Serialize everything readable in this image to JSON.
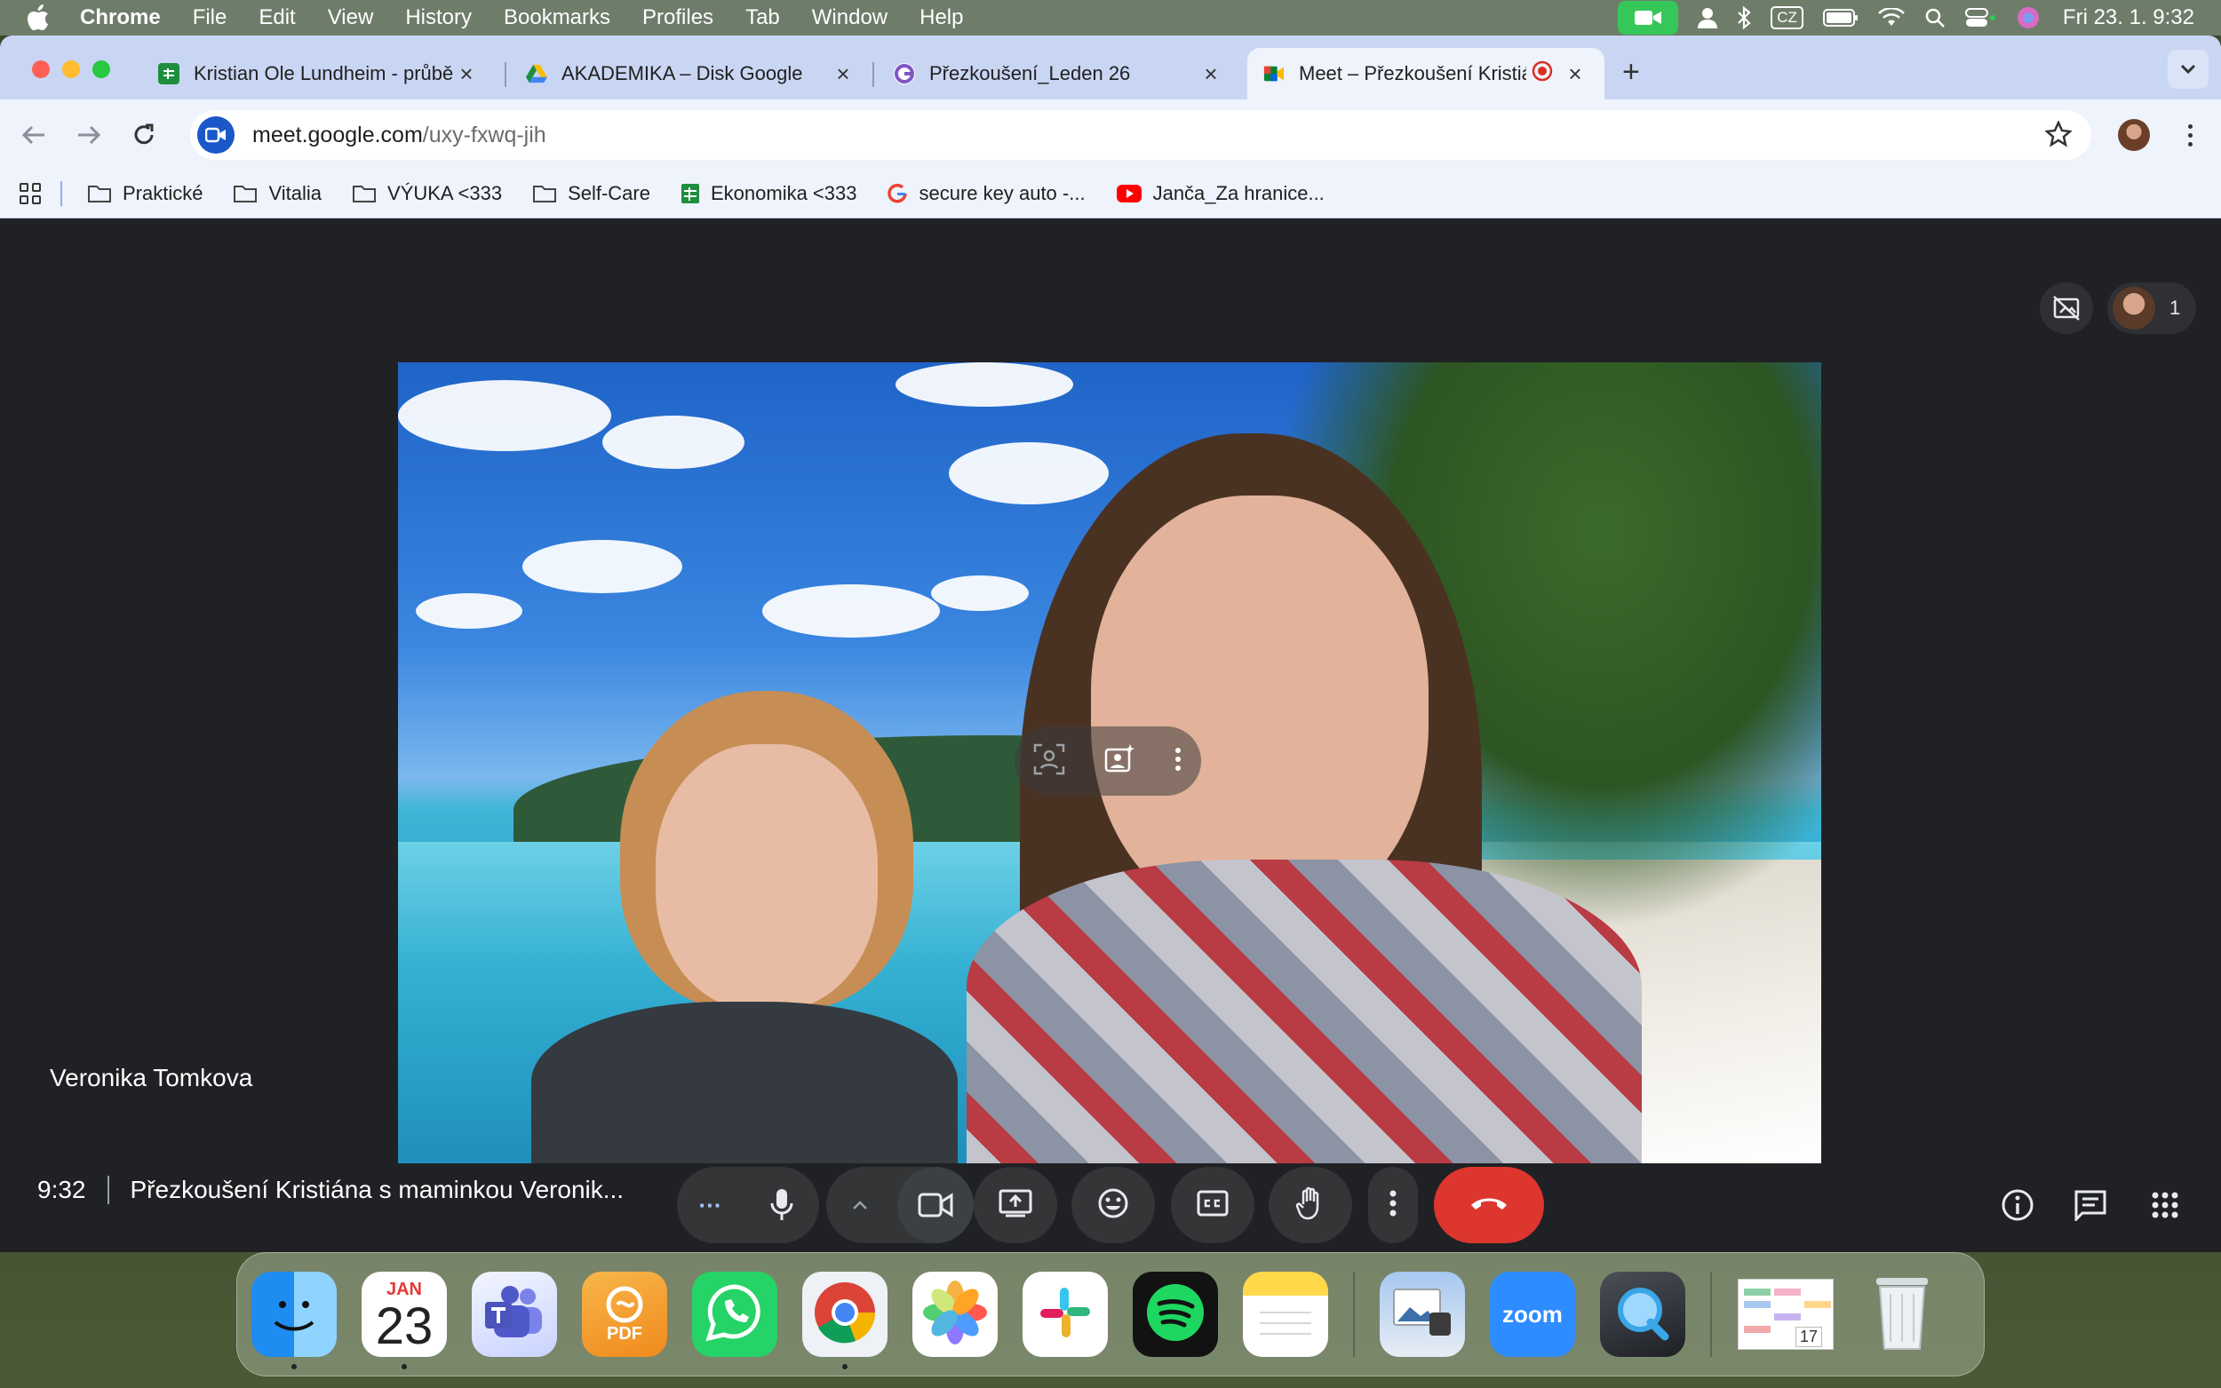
{
  "menubar": {
    "app": "Chrome",
    "items": [
      "File",
      "Edit",
      "View",
      "History",
      "Bookmarks",
      "Profiles",
      "Tab",
      "Window",
      "Help"
    ],
    "input_source": "CZ",
    "clock": "Fri 23. 1.  9:32"
  },
  "tabs": [
    {
      "title": "Kristian Ole Lundheim - průběh",
      "favicon": "sheets-icon",
      "close": "×"
    },
    {
      "title": "AKADEMIKA – Disk Google",
      "favicon": "drive-icon",
      "close": "×"
    },
    {
      "title": "Přezkoušení_Leden 26",
      "favicon": "google-icon",
      "close": "×"
    },
    {
      "title": "Meet – Přezkoušení Kristiána",
      "favicon": "meet-icon",
      "close": "×",
      "active": true,
      "recording": true
    }
  ],
  "new_tab_label": "+",
  "address": {
    "host": "meet.google.com",
    "path": "/uxy-fxwq-jih"
  },
  "bookmarks": [
    {
      "label": "Praktické",
      "icon": "folder-icon"
    },
    {
      "label": "Vitalia",
      "icon": "folder-icon"
    },
    {
      "label": "VÝUKA <333",
      "icon": "folder-icon"
    },
    {
      "label": "Self-Care",
      "icon": "folder-icon"
    },
    {
      "label": "Ekonomika <333",
      "icon": "sheets-icon"
    },
    {
      "label": "secure key auto -...",
      "icon": "google-icon"
    },
    {
      "label": "Janča_Za hranice...",
      "icon": "youtube-icon"
    }
  ],
  "meet": {
    "participant_count": "1",
    "speaker_name": "Veronika Tomkova",
    "time": "9:32",
    "meeting_title": "Přezkoušení Kristiána s maminkou Veronik...",
    "more_label": "···"
  },
  "dock": {
    "calendar_month": "JAN",
    "calendar_day": "23",
    "pdf_label": "PDF",
    "zoom_label": "zoom",
    "mini_cal_day": "17"
  },
  "colors": {
    "end_call": "#dc362e",
    "meet_bg": "#202124",
    "chrome_tabstrip": "#c9d6f3",
    "mac_green": "#35c759"
  }
}
